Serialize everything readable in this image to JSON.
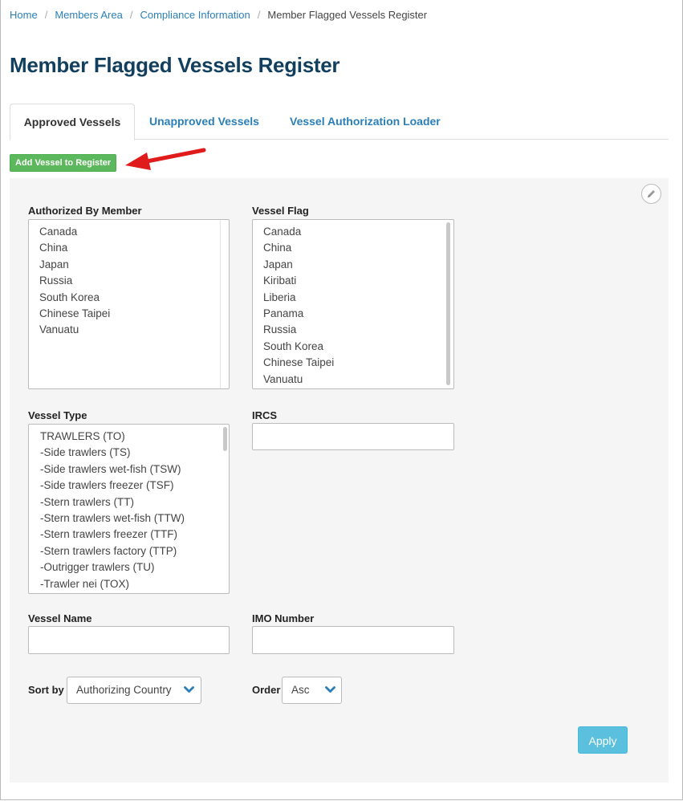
{
  "breadcrumb": {
    "items": [
      "Home",
      "Members Area",
      "Compliance Information"
    ],
    "current": "Member Flagged Vessels Register"
  },
  "page_title": "Member Flagged Vessels Register",
  "tabs": [
    {
      "label": "Approved Vessels",
      "active": true
    },
    {
      "label": "Unapproved Vessels",
      "active": false
    },
    {
      "label": "Vessel Authorization Loader",
      "active": false
    }
  ],
  "add_button_label": "Add Vessel to Register",
  "filters": {
    "authorized_by_member": {
      "label": "Authorized By Member",
      "options": [
        "Canada",
        "China",
        "Japan",
        "Russia",
        "South Korea",
        "Chinese Taipei",
        "Vanuatu"
      ]
    },
    "vessel_flag": {
      "label": "Vessel Flag",
      "options": [
        "Canada",
        "China",
        "Japan",
        "Kiribati",
        "Liberia",
        "Panama",
        "Russia",
        "South Korea",
        "Chinese Taipei",
        "Vanuatu"
      ]
    },
    "vessel_type": {
      "label": "Vessel Type",
      "options": [
        "TRAWLERS (TO)",
        "-Side trawlers (TS)",
        "-Side trawlers wet-fish (TSW)",
        "-Side trawlers freezer (TSF)",
        "-Stern trawlers (TT)",
        "-Stern trawlers wet-fish (TTW)",
        "-Stern trawlers freezer (TTF)",
        "-Stern trawlers factory (TTP)",
        "-Outrigger trawlers (TU)",
        "-Trawler nei (TOX)"
      ]
    },
    "ircs": {
      "label": "IRCS",
      "value": ""
    },
    "vessel_name": {
      "label": "Vessel Name",
      "value": ""
    },
    "imo_number": {
      "label": "IMO Number",
      "value": ""
    },
    "sort_by": {
      "label": "Sort by",
      "selected": "Authorizing Country"
    },
    "order": {
      "label": "Order",
      "selected": "Asc"
    }
  },
  "apply_label": "Apply",
  "colors": {
    "link": "#2a7fb8",
    "title": "#123f5e",
    "add_button": "#5cb85c",
    "apply_button": "#5bc0de",
    "annotation_arrow": "#e01b1b"
  },
  "icons": {
    "edit": "pencil-icon",
    "dropdown": "chevron-down-icon",
    "annotation": "red-arrow"
  }
}
